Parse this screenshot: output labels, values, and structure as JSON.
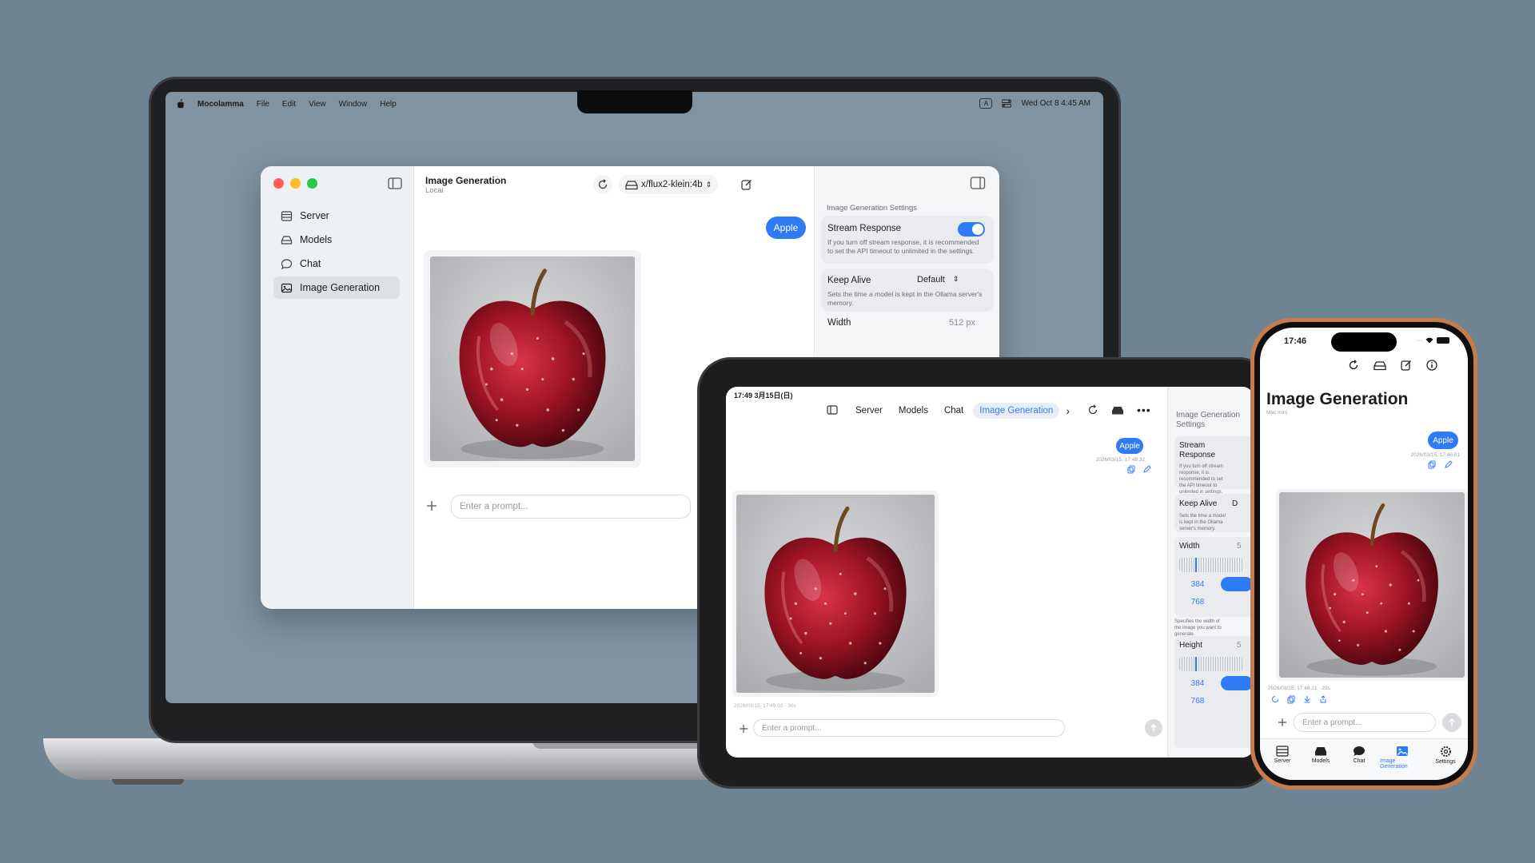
{
  "mac": {
    "menubar": {
      "app_name": "Mocolamma",
      "menus": [
        "File",
        "Edit",
        "View",
        "Window",
        "Help"
      ],
      "clock": "Wed Oct 8  4:45 AM"
    },
    "sidebar": {
      "items": [
        {
          "label": "Server",
          "icon": "server-icon"
        },
        {
          "label": "Models",
          "icon": "models-icon"
        },
        {
          "label": "Chat",
          "icon": "chat-icon"
        },
        {
          "label": "Image Generation",
          "icon": "image-icon",
          "selected": true
        }
      ]
    },
    "main": {
      "title": "Image Generation",
      "subtitle": "Local",
      "model": "x/flux2-klein:4b",
      "user_message": "Apple",
      "prompt_placeholder": "Enter a prompt..."
    },
    "settings": {
      "header": "Image Generation Settings",
      "stream_label": "Stream Response",
      "stream_on": true,
      "stream_desc": "If you turn off stream response, it is recommended to set the API timeout to unlimited in the settings.",
      "keep_alive_label": "Keep Alive",
      "keep_alive_value": "Default",
      "keep_alive_desc": "Sets the time a model is kept in the Ollama server's memory.",
      "width_label": "Width",
      "width_value": "512  px"
    }
  },
  "ipad": {
    "status_time": "17:49  3月15日(日)",
    "tabs": [
      "Server",
      "Models",
      "Chat",
      "Image Generation"
    ],
    "selected_tab": "Image Generation",
    "user_message": "Apple",
    "message_time": "2026/03/15, 17:48:32",
    "image_time": "2026/03/15, 17:49:03 · 30s",
    "prompt_placeholder": "Enter a prompt...",
    "settings": {
      "header": "Image Generation Settings",
      "stream_label": "Stream Response",
      "stream_desc": "If you turn off stream response, it is recommended to set the API timeout to unlimited in settings.",
      "keep_alive_label": "Keep Alive",
      "keep_alive_value": "D",
      "keep_alive_desc": "Sets the time a model is kept in the Ollama server's memory.",
      "width_label": "Width",
      "width_value": "5",
      "width_chips": [
        "384",
        "768"
      ],
      "width_desc": "Specifies the width of the image you want to generate.",
      "height_label": "Height",
      "height_value": "5",
      "height_chips": [
        "384",
        "768"
      ]
    }
  },
  "iphone": {
    "status_time": "17:46",
    "title": "Image Generation",
    "subtitle": "Mac mini",
    "user_message": "Apple",
    "message_time": "2026/03/15, 17:46:01",
    "image_time": "2026/03/15, 17:46:21 · 20s",
    "prompt_placeholder": "Enter a prompt...",
    "tabbar": [
      "Server",
      "Models",
      "Chat",
      "Image Generation",
      "Settings"
    ],
    "selected_tab": "Image Generation"
  },
  "colors": {
    "background": "#6f8493",
    "accent": "#2f7bf6",
    "iphone_frame": "#c67b4c"
  }
}
